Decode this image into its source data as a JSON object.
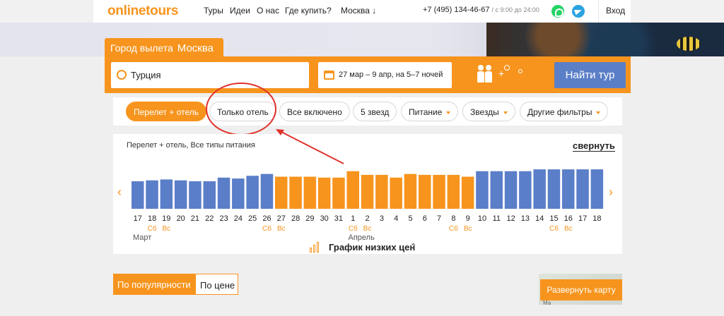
{
  "header": {
    "logo_online": "online",
    "logo_tours": "tours",
    "nav": [
      "Туры",
      "Идеи",
      "О нас",
      "Где купить?"
    ],
    "city_select": "Москва ↓",
    "phone": "+7 (495) 134-46-67",
    "phone_hours": "/ с 9:00 до 24:00",
    "login": "Вход"
  },
  "search": {
    "departure_label": "Город вылета",
    "departure_city": "Москва",
    "destination": "Турция",
    "dates": "27 мар – 9 апр, на 5–7 ночей",
    "tourists_extra": "+",
    "find_button": "Найти тур"
  },
  "filters": {
    "chips": [
      "Перелет + отель",
      "Только отель",
      "Все включено",
      "5 звезд",
      "Питание",
      "Звезды",
      "Другие фильтры"
    ]
  },
  "chart": {
    "subtitle": "Перелет + отель, Все типы питания",
    "collapse": "свернуть",
    "low_price_title": "График низких цен",
    "colors": {
      "blue": "#5b7ec9",
      "orange": "#f7941d"
    }
  },
  "chart_data": {
    "type": "bar",
    "categories": [
      "17",
      "18",
      "19",
      "20",
      "21",
      "22",
      "23",
      "24",
      "25",
      "26",
      "27",
      "28",
      "29",
      "30",
      "31",
      "1",
      "2",
      "3",
      "4",
      "5",
      "6",
      "7",
      "8",
      "9",
      "10",
      "11",
      "12",
      "13",
      "14",
      "15",
      "16",
      "17",
      "18"
    ],
    "values": [
      30,
      31,
      32,
      31,
      30,
      30,
      34,
      33,
      36,
      38,
      35,
      35,
      35,
      34,
      34,
      41,
      37,
      37,
      34,
      38,
      37,
      37,
      37,
      35,
      41,
      41,
      41,
      41,
      43,
      43,
      43,
      43,
      43
    ],
    "colors": [
      "blue",
      "blue",
      "blue",
      "blue",
      "blue",
      "blue",
      "blue",
      "blue",
      "blue",
      "blue",
      "orange",
      "orange",
      "orange",
      "orange",
      "orange",
      "orange",
      "orange",
      "orange",
      "orange",
      "orange",
      "orange",
      "orange",
      "orange",
      "orange",
      "blue",
      "blue",
      "blue",
      "blue",
      "blue",
      "blue",
      "blue",
      "blue",
      "blue"
    ],
    "weekday_labels": {
      "1": "Сб",
      "2": "Вс",
      "9": "Сб",
      "10": "Вс",
      "15": "Сб",
      "16": "Вс",
      "22": "Сб",
      "23": "Вс",
      "29": "Сб",
      "30": "Вс"
    },
    "months": [
      {
        "index": 0,
        "name": "Март"
      },
      {
        "index": 15,
        "name": "Апрель"
      }
    ]
  },
  "sort": {
    "popularity": "По популярности",
    "price": "По цене"
  },
  "map": {
    "expand": "Развернуть карту",
    "label": "Ма"
  }
}
